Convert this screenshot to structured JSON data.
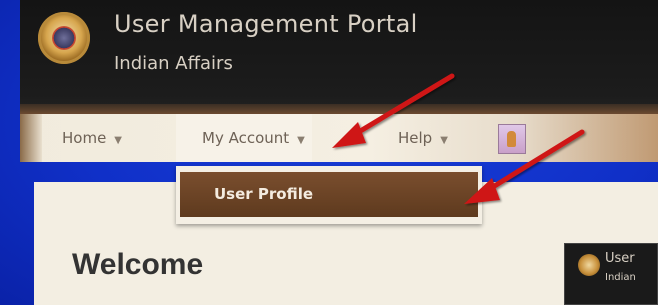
{
  "header": {
    "title": "User Management Portal",
    "subtitle": "Indian Affairs",
    "logo_icon": "seal-logo-icon"
  },
  "nav": {
    "items": [
      {
        "label": "Home",
        "caret": "▼"
      },
      {
        "label": "My Account",
        "caret": "▼"
      },
      {
        "label": "Help",
        "caret": "▼"
      }
    ],
    "badge_icon": "user-badge-icon"
  },
  "dropdown": {
    "items": [
      {
        "label": "User Profile"
      }
    ]
  },
  "main": {
    "heading": "Welcome"
  },
  "thumbnail": {
    "title": "User",
    "subtitle": "Indian"
  },
  "colors": {
    "background_blue": "#1030c8",
    "header_dark": "#1a1a1a",
    "nav_bg": "#f1ebdd",
    "dropdown_highlight": "#6b4426",
    "arrow_red": "#d01818"
  }
}
